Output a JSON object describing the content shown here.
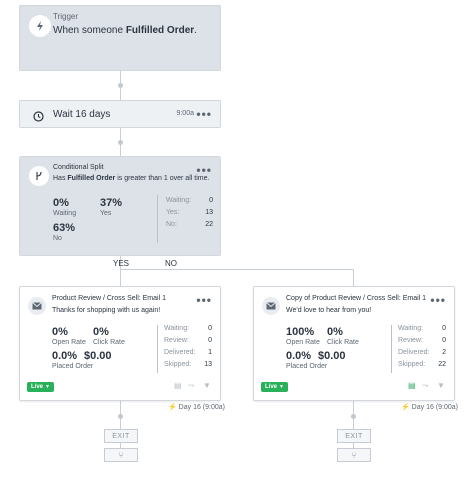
{
  "trigger": {
    "label": "Trigger",
    "prefix": "When someone",
    "metric": "Fulfilled Order",
    "suffix": "."
  },
  "wait": {
    "label": "Wait 16 days",
    "time": "9:00a",
    "menu": "•••"
  },
  "split": {
    "title": "Conditional Split",
    "cond_prefix": "Has",
    "cond_metric": "Fulfilled Order",
    "cond_suffix": "is greater than 1 over all time.",
    "waiting_pct": "0%",
    "waiting_label": "Waiting",
    "yes_pct": "37%",
    "yes_label": "Yes",
    "no_pct": "63%",
    "no_label": "No",
    "stats": [
      {
        "label": "Waiting:",
        "value": "0"
      },
      {
        "label": "Yes:",
        "value": "13"
      },
      {
        "label": "No:",
        "value": "22"
      }
    ],
    "menu": "•••"
  },
  "branches": {
    "yes": "YES",
    "no": "NO"
  },
  "emails": [
    {
      "title": "Product Review / Cross Sell: Email 1",
      "subject": "Thanks for shopping with us again!",
      "open_rate": "0%",
      "open_label": "Open Rate",
      "click_rate": "0%",
      "click_label": "Click Rate",
      "placed_rate": "0.0%",
      "placed_value": "$0.00",
      "placed_label": "Placed Order",
      "stats": [
        {
          "label": "Waiting:",
          "value": "0"
        },
        {
          "label": "Review:",
          "value": "0"
        },
        {
          "label": "Delivered:",
          "value": "1"
        },
        {
          "label": "Skipped:",
          "value": "13"
        }
      ],
      "live": "Live",
      "day": "Day 16 (9:00a)",
      "menu": "•••"
    },
    {
      "title": "Copy of Product Review / Cross Sell: Email 1",
      "subject": "We'd love to hear from you!",
      "open_rate": "100%",
      "open_label": "Open Rate",
      "click_rate": "0%",
      "click_label": "Click Rate",
      "placed_rate": "0.0%",
      "placed_value": "$0.00",
      "placed_label": "Placed Order",
      "stats": [
        {
          "label": "Waiting:",
          "value": "0"
        },
        {
          "label": "Review:",
          "value": "0"
        },
        {
          "label": "Delivered:",
          "value": "2"
        },
        {
          "label": "Skipped:",
          "value": "22"
        }
      ],
      "live": "Live",
      "day": "Day 16 (9:00a)",
      "menu": "•••"
    }
  ],
  "exit": {
    "label": "EXIT"
  },
  "colors": {
    "live": "#28b05a",
    "card_grey": "#dde2e8",
    "connector": "#c9cfd6"
  },
  "icons": [
    "lightning-icon",
    "clock-icon",
    "split-icon",
    "envelope-icon",
    "chevron-down-icon",
    "bolt-icon",
    "merge-icon"
  ]
}
